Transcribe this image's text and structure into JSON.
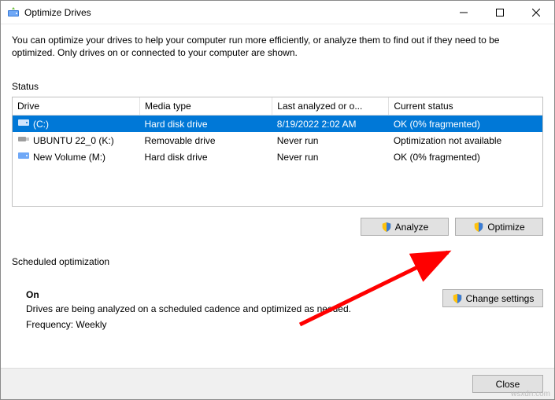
{
  "titlebar": {
    "title": "Optimize Drives"
  },
  "intro": "You can optimize your drives to help your computer run more efficiently, or analyze them to find out if they need to be optimized. Only drives on or connected to your computer are shown.",
  "section_status": "Status",
  "columns": {
    "drive": "Drive",
    "media": "Media type",
    "last": "Last analyzed or o...",
    "status": "Current status"
  },
  "rows": [
    {
      "drive": "(C:)",
      "media": "Hard disk drive",
      "last": "8/19/2022 2:02 AM",
      "status": "OK (0% fragmented)",
      "icon": "hdd",
      "selected": true
    },
    {
      "drive": "UBUNTU 22_0 (K:)",
      "media": "Removable drive",
      "last": "Never run",
      "status": "Optimization not available",
      "icon": "usb",
      "selected": false
    },
    {
      "drive": "New Volume (M:)",
      "media": "Hard disk drive",
      "last": "Never run",
      "status": "OK (0% fragmented)",
      "icon": "hdd",
      "selected": false
    }
  ],
  "buttons": {
    "analyze": "Analyze",
    "optimize": "Optimize",
    "change_settings": "Change settings",
    "close": "Close"
  },
  "sched": {
    "label": "Scheduled optimization",
    "on": "On",
    "desc": "Drives are being analyzed on a scheduled cadence and optimized as needed.",
    "freq": "Frequency: Weekly"
  },
  "watermark": "wsxdn.com"
}
